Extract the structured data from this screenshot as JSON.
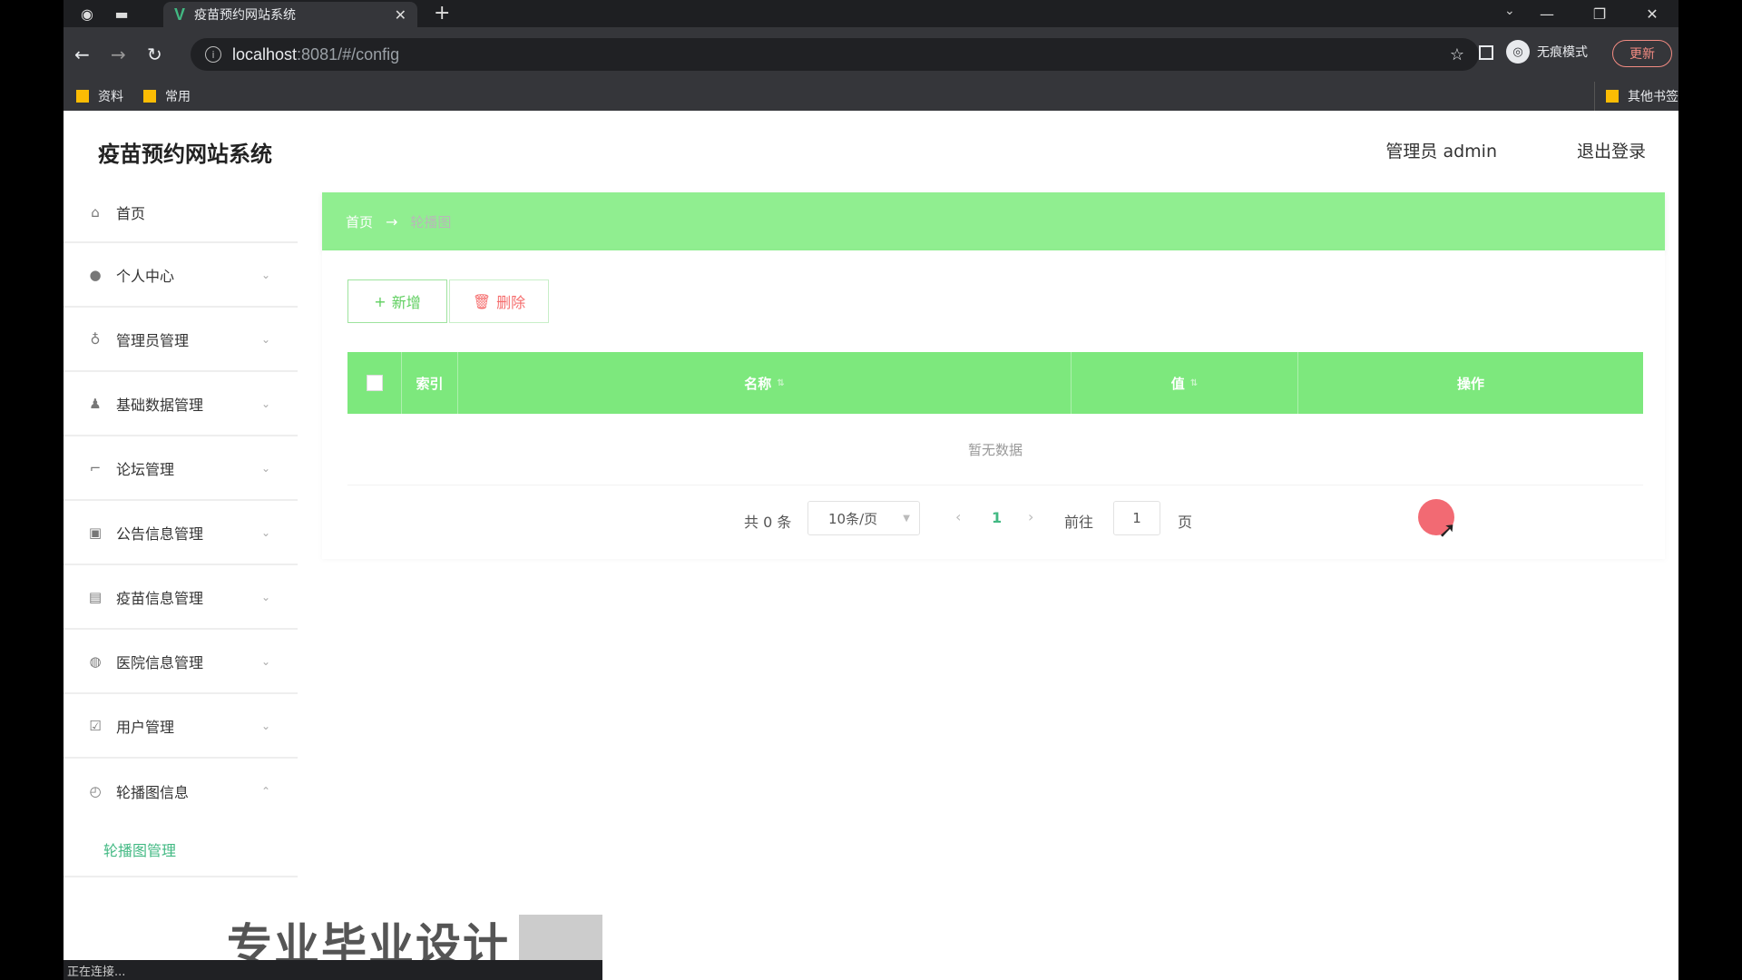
{
  "browser": {
    "tab_title": "疫苗预约网站系统",
    "favicon": "V",
    "url_host": "localhost",
    "url_path": ":8081/#/config",
    "incognito_label": "无痕模式",
    "update_label": "更新",
    "bookmarks": [
      {
        "label": "资料"
      },
      {
        "label": "常用"
      }
    ],
    "other_bookmarks": "其他书签",
    "status_text": "正在连接..."
  },
  "app": {
    "title": "疫苗预约网站系统",
    "user_info": "管理员 admin",
    "logout": "退出登录"
  },
  "sidebar": {
    "items": [
      {
        "label": "首页",
        "icon": "home-icon"
      },
      {
        "label": "个人中心",
        "icon": "user-icon"
      },
      {
        "label": "管理员管理",
        "icon": "microphone-icon"
      },
      {
        "label": "基础数据管理",
        "icon": "person-icon"
      },
      {
        "label": "论坛管理",
        "icon": "crop-icon"
      },
      {
        "label": "公告信息管理",
        "icon": "picture-icon"
      },
      {
        "label": "疫苗信息管理",
        "icon": "printer-icon"
      },
      {
        "label": "医院信息管理",
        "icon": "basketball-icon"
      },
      {
        "label": "用户管理",
        "icon": "checkbox-icon"
      },
      {
        "label": "轮播图信息",
        "icon": "compass-icon"
      }
    ],
    "submenu_label": "轮播图管理"
  },
  "breadcrumb": {
    "home": "首页",
    "separator": "→",
    "current": "轮播图"
  },
  "actions": {
    "add_label": "新增",
    "delete_label": "删除"
  },
  "table": {
    "columns": [
      "索引",
      "名称",
      "值",
      "操作"
    ],
    "empty_text": "暂无数据"
  },
  "pager": {
    "total": "共 0 条",
    "page_size": "10条/页",
    "current_page": "1",
    "goto_label": "前往",
    "goto_value": "1",
    "page_suffix": "页"
  },
  "watermark": "专业毕业设计",
  "colors": {
    "accent": "#90ee90",
    "table_header": "#7de87d",
    "link": "#42b983",
    "danger": "#f56c6c"
  }
}
